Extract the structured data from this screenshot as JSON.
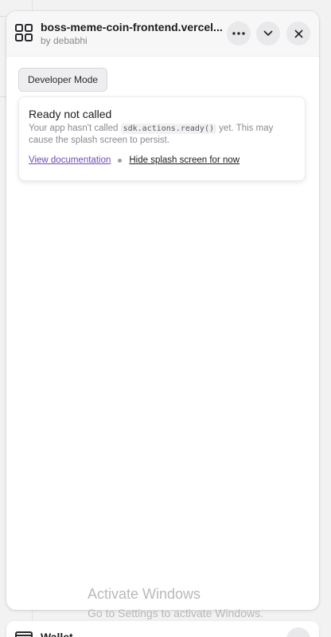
{
  "header": {
    "title": "boss-meme-coin-frontend.vercel...",
    "author": "by debabhi"
  },
  "icons": {
    "app": "grid-app-icon",
    "more": "more-horizontal-icon",
    "collapse": "chevron-down-icon",
    "close": "close-icon",
    "wallet": "wallet-icon"
  },
  "dev_mode_label": "Developer Mode",
  "notice": {
    "title": "Ready not called",
    "body_prefix": "Your app hasn't called ",
    "code": "sdk.actions.ready()",
    "body_suffix": " yet. This may cause the splash screen to persist.",
    "doc_link": "View documentation",
    "hide_link": "Hide splash screen for now"
  },
  "watermark": {
    "title": "Activate Windows",
    "subtitle": "Go to Settings to activate Windows."
  },
  "bottom": {
    "label": "Wallet"
  },
  "colors": {
    "link": "#6d4ab8",
    "header_bg": "#f7f7f8",
    "page_bg": "#f2f2f3"
  }
}
